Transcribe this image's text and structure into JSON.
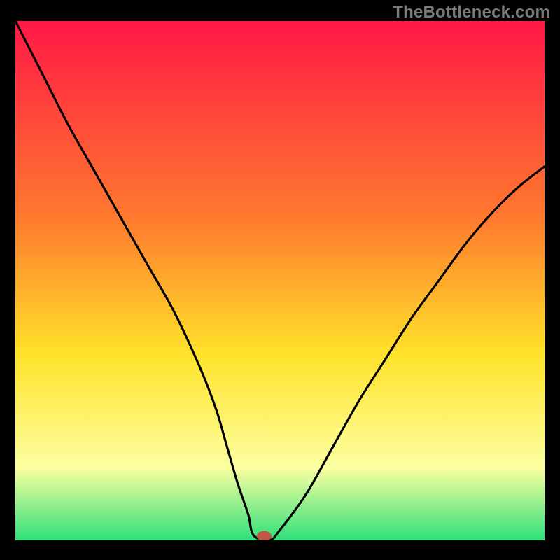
{
  "watermark": "TheBottleneck.com",
  "colors": {
    "top": "#ff1846",
    "mid1": "#ff7a2e",
    "mid2": "#ffe22a",
    "mid3": "#fbffa0",
    "bottom": "#2fe07a",
    "curve": "#000000",
    "marker": "#c0584a",
    "frame": "#000000"
  },
  "chart_data": {
    "type": "line",
    "title": "",
    "xlabel": "",
    "ylabel": "",
    "xlim": [
      0,
      100
    ],
    "ylim": [
      0,
      100
    ],
    "x": [
      0,
      2,
      5,
      10,
      15,
      20,
      25,
      30,
      35,
      38,
      40,
      42,
      44,
      45,
      48,
      50,
      55,
      60,
      65,
      70,
      75,
      80,
      85,
      90,
      95,
      100
    ],
    "y": [
      100,
      96,
      90,
      80,
      71,
      62,
      53,
      44,
      33,
      25,
      18,
      11,
      5,
      1,
      0,
      2,
      9,
      18,
      27,
      35,
      43,
      50,
      57,
      63,
      68,
      72
    ],
    "marker": {
      "x": 47,
      "y": 0.8,
      "rx": 1.4,
      "ry": 1.0
    }
  }
}
